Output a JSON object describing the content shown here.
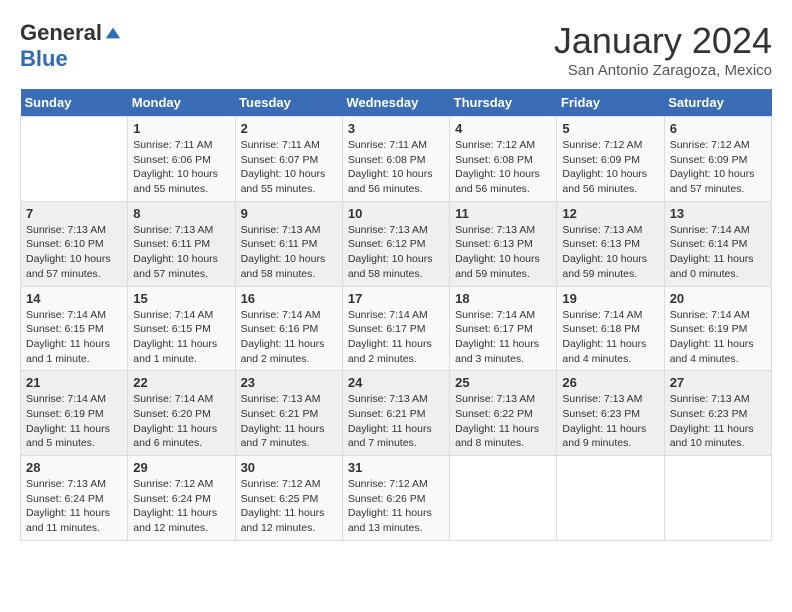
{
  "logo": {
    "general": "General",
    "blue": "Blue"
  },
  "header": {
    "month": "January 2024",
    "location": "San Antonio Zaragoza, Mexico"
  },
  "days_of_week": [
    "Sunday",
    "Monday",
    "Tuesday",
    "Wednesday",
    "Thursday",
    "Friday",
    "Saturday"
  ],
  "weeks": [
    [
      {
        "day": "",
        "sunrise": "",
        "sunset": "",
        "daylight": ""
      },
      {
        "day": "1",
        "sunrise": "Sunrise: 7:11 AM",
        "sunset": "Sunset: 6:06 PM",
        "daylight": "Daylight: 10 hours and 55 minutes."
      },
      {
        "day": "2",
        "sunrise": "Sunrise: 7:11 AM",
        "sunset": "Sunset: 6:07 PM",
        "daylight": "Daylight: 10 hours and 55 minutes."
      },
      {
        "day": "3",
        "sunrise": "Sunrise: 7:11 AM",
        "sunset": "Sunset: 6:08 PM",
        "daylight": "Daylight: 10 hours and 56 minutes."
      },
      {
        "day": "4",
        "sunrise": "Sunrise: 7:12 AM",
        "sunset": "Sunset: 6:08 PM",
        "daylight": "Daylight: 10 hours and 56 minutes."
      },
      {
        "day": "5",
        "sunrise": "Sunrise: 7:12 AM",
        "sunset": "Sunset: 6:09 PM",
        "daylight": "Daylight: 10 hours and 56 minutes."
      },
      {
        "day": "6",
        "sunrise": "Sunrise: 7:12 AM",
        "sunset": "Sunset: 6:09 PM",
        "daylight": "Daylight: 10 hours and 57 minutes."
      }
    ],
    [
      {
        "day": "7",
        "sunrise": "Sunrise: 7:13 AM",
        "sunset": "Sunset: 6:10 PM",
        "daylight": "Daylight: 10 hours and 57 minutes."
      },
      {
        "day": "8",
        "sunrise": "Sunrise: 7:13 AM",
        "sunset": "Sunset: 6:11 PM",
        "daylight": "Daylight: 10 hours and 57 minutes."
      },
      {
        "day": "9",
        "sunrise": "Sunrise: 7:13 AM",
        "sunset": "Sunset: 6:11 PM",
        "daylight": "Daylight: 10 hours and 58 minutes."
      },
      {
        "day": "10",
        "sunrise": "Sunrise: 7:13 AM",
        "sunset": "Sunset: 6:12 PM",
        "daylight": "Daylight: 10 hours and 58 minutes."
      },
      {
        "day": "11",
        "sunrise": "Sunrise: 7:13 AM",
        "sunset": "Sunset: 6:13 PM",
        "daylight": "Daylight: 10 hours and 59 minutes."
      },
      {
        "day": "12",
        "sunrise": "Sunrise: 7:13 AM",
        "sunset": "Sunset: 6:13 PM",
        "daylight": "Daylight: 10 hours and 59 minutes."
      },
      {
        "day": "13",
        "sunrise": "Sunrise: 7:14 AM",
        "sunset": "Sunset: 6:14 PM",
        "daylight": "Daylight: 11 hours and 0 minutes."
      }
    ],
    [
      {
        "day": "14",
        "sunrise": "Sunrise: 7:14 AM",
        "sunset": "Sunset: 6:15 PM",
        "daylight": "Daylight: 11 hours and 1 minute."
      },
      {
        "day": "15",
        "sunrise": "Sunrise: 7:14 AM",
        "sunset": "Sunset: 6:15 PM",
        "daylight": "Daylight: 11 hours and 1 minute."
      },
      {
        "day": "16",
        "sunrise": "Sunrise: 7:14 AM",
        "sunset": "Sunset: 6:16 PM",
        "daylight": "Daylight: 11 hours and 2 minutes."
      },
      {
        "day": "17",
        "sunrise": "Sunrise: 7:14 AM",
        "sunset": "Sunset: 6:17 PM",
        "daylight": "Daylight: 11 hours and 2 minutes."
      },
      {
        "day": "18",
        "sunrise": "Sunrise: 7:14 AM",
        "sunset": "Sunset: 6:17 PM",
        "daylight": "Daylight: 11 hours and 3 minutes."
      },
      {
        "day": "19",
        "sunrise": "Sunrise: 7:14 AM",
        "sunset": "Sunset: 6:18 PM",
        "daylight": "Daylight: 11 hours and 4 minutes."
      },
      {
        "day": "20",
        "sunrise": "Sunrise: 7:14 AM",
        "sunset": "Sunset: 6:19 PM",
        "daylight": "Daylight: 11 hours and 4 minutes."
      }
    ],
    [
      {
        "day": "21",
        "sunrise": "Sunrise: 7:14 AM",
        "sunset": "Sunset: 6:19 PM",
        "daylight": "Daylight: 11 hours and 5 minutes."
      },
      {
        "day": "22",
        "sunrise": "Sunrise: 7:14 AM",
        "sunset": "Sunset: 6:20 PM",
        "daylight": "Daylight: 11 hours and 6 minutes."
      },
      {
        "day": "23",
        "sunrise": "Sunrise: 7:13 AM",
        "sunset": "Sunset: 6:21 PM",
        "daylight": "Daylight: 11 hours and 7 minutes."
      },
      {
        "day": "24",
        "sunrise": "Sunrise: 7:13 AM",
        "sunset": "Sunset: 6:21 PM",
        "daylight": "Daylight: 11 hours and 7 minutes."
      },
      {
        "day": "25",
        "sunrise": "Sunrise: 7:13 AM",
        "sunset": "Sunset: 6:22 PM",
        "daylight": "Daylight: 11 hours and 8 minutes."
      },
      {
        "day": "26",
        "sunrise": "Sunrise: 7:13 AM",
        "sunset": "Sunset: 6:23 PM",
        "daylight": "Daylight: 11 hours and 9 minutes."
      },
      {
        "day": "27",
        "sunrise": "Sunrise: 7:13 AM",
        "sunset": "Sunset: 6:23 PM",
        "daylight": "Daylight: 11 hours and 10 minutes."
      }
    ],
    [
      {
        "day": "28",
        "sunrise": "Sunrise: 7:13 AM",
        "sunset": "Sunset: 6:24 PM",
        "daylight": "Daylight: 11 hours and 11 minutes."
      },
      {
        "day": "29",
        "sunrise": "Sunrise: 7:12 AM",
        "sunset": "Sunset: 6:24 PM",
        "daylight": "Daylight: 11 hours and 12 minutes."
      },
      {
        "day": "30",
        "sunrise": "Sunrise: 7:12 AM",
        "sunset": "Sunset: 6:25 PM",
        "daylight": "Daylight: 11 hours and 12 minutes."
      },
      {
        "day": "31",
        "sunrise": "Sunrise: 7:12 AM",
        "sunset": "Sunset: 6:26 PM",
        "daylight": "Daylight: 11 hours and 13 minutes."
      },
      {
        "day": "",
        "sunrise": "",
        "sunset": "",
        "daylight": ""
      },
      {
        "day": "",
        "sunrise": "",
        "sunset": "",
        "daylight": ""
      },
      {
        "day": "",
        "sunrise": "",
        "sunset": "",
        "daylight": ""
      }
    ]
  ]
}
